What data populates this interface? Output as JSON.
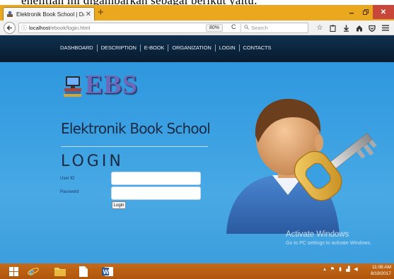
{
  "caption": {
    "text": "enelitian ini digambarkan sebagai berikut yaitu:"
  },
  "browser": {
    "tab_title": "Elektronik Book School | Da",
    "url_host": "localhost",
    "url_path": "/ebook/login.html",
    "zoom": "80%",
    "search_placeholder": "Search",
    "icons": {
      "back": "back-arrow-icon",
      "info": "info-icon",
      "reload": "reload-icon",
      "search": "search-icon",
      "bookmark": "star-icon",
      "reader": "clipboard-icon",
      "download": "download-arrow-icon",
      "home": "home-icon",
      "pocket": "shield-icon",
      "menu": "hamburger-menu-icon"
    }
  },
  "site": {
    "nav": [
      "DASHBOARD",
      "DESCRIPTION",
      "E-BOOK",
      "ORGANIZATION",
      "LOGIN",
      "CONTACTS"
    ],
    "logo_text": "EBS",
    "school_name": "Elektronik Book School",
    "login_title": "LOGIN",
    "user_label": "User ID",
    "password_label": "Password",
    "user_value": "",
    "password_value": "",
    "login_button": "Login"
  },
  "watermark": {
    "line1": "Activate Windows",
    "line2": "Go to PC settings to activate Windows."
  },
  "taskbar": {
    "time": "11:08 AM",
    "date": "8/19/2017",
    "icons": [
      "windows-start-icon",
      "internet-explorer-icon",
      "file-explorer-icon",
      "document-icon",
      "word-icon"
    ]
  },
  "colors": {
    "tab_strip": "#eaa81f",
    "page_blue": "#3aa0e2",
    "nav_dark": "#0b2540",
    "taskbar": "#b85e12",
    "close_red": "#c9463a"
  }
}
